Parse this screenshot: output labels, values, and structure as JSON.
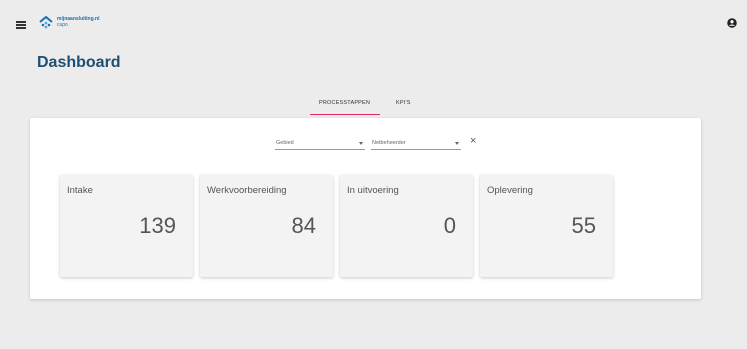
{
  "header": {
    "logo_brand": "mijnaansluiting.nl",
    "logo_sub": "cupo"
  },
  "page_title": "Dashboard",
  "tabs": [
    {
      "label": "PROCESSTAPPEN",
      "active": true
    },
    {
      "label": "KPI'S",
      "active": false
    }
  ],
  "filters": {
    "gebied": {
      "placeholder": "Gebied"
    },
    "netbeheerder": {
      "placeholder": "Netbeheerder"
    },
    "clear_label": "×"
  },
  "tiles": [
    {
      "label": "Intake",
      "value": "139"
    },
    {
      "label": "Werkvoorbereiding",
      "value": "84"
    },
    {
      "label": "In uitvoering",
      "value": "0"
    },
    {
      "label": "Oplevering",
      "value": "55"
    }
  ],
  "colors": {
    "accent": "#e0285d",
    "title": "#1f4f72",
    "brand": "#1a6fb0"
  },
  "icons": {
    "menu": "hamburger-menu-icon",
    "logo": "mijnaansluiting-logo-icon",
    "account": "account-circle-icon",
    "dropdown": "caret-down-icon",
    "clear": "close-icon"
  }
}
